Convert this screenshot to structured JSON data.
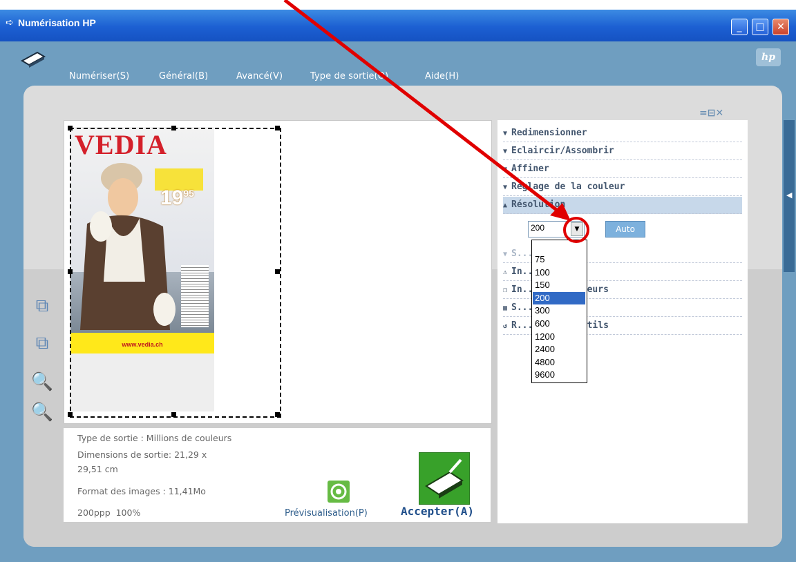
{
  "window": {
    "title": "Numérisation HP"
  },
  "menu": [
    {
      "label": "Numériser(S)"
    },
    {
      "label": "Général(B)"
    },
    {
      "label": "Avancé(V)"
    },
    {
      "label": "Type de sortie(O)"
    },
    {
      "label": "Aide(H)"
    }
  ],
  "tools": {
    "items": [
      {
        "label": "Redimensionner"
      },
      {
        "label": "Eclaircir/Assombrir"
      },
      {
        "label": "Affiner"
      },
      {
        "label": "Réglage de la couleur"
      },
      {
        "label": "Résolution"
      },
      {
        "label": "S... et blanc"
      },
      {
        "label": "In..."
      },
      {
        "label": "In... des couleurs"
      },
      {
        "label": "S... le moiré"
      },
      {
        "label": "R... er les outils"
      }
    ],
    "resolution": {
      "value": "200",
      "auto_label": "Auto",
      "options": [
        "75",
        "100",
        "150",
        "200",
        "300",
        "600",
        "1200",
        "2400",
        "4800",
        "9600"
      ],
      "selected": "200"
    }
  },
  "info": {
    "output_type": "Type de sortie : Millions de couleurs",
    "dimensions_1": "Dimensions de sortie: 21,29 x",
    "dimensions_2": "29,51 cm",
    "image_format": "Format des images : 11,41Mo",
    "status": "200ppp  100%"
  },
  "actions": {
    "preview_label": "Prévisualisation(P)",
    "accept_label": "Accepter(A)"
  },
  "preview_image": {
    "brand": "VEDIA",
    "price": "19",
    "price_cents": "95",
    "url": "www.vedia.ch"
  },
  "colors": {
    "titlebar": "#1c5fd2",
    "frame": "#6f9ec0",
    "accent": "#316ac5",
    "accept": "#38a12a"
  }
}
